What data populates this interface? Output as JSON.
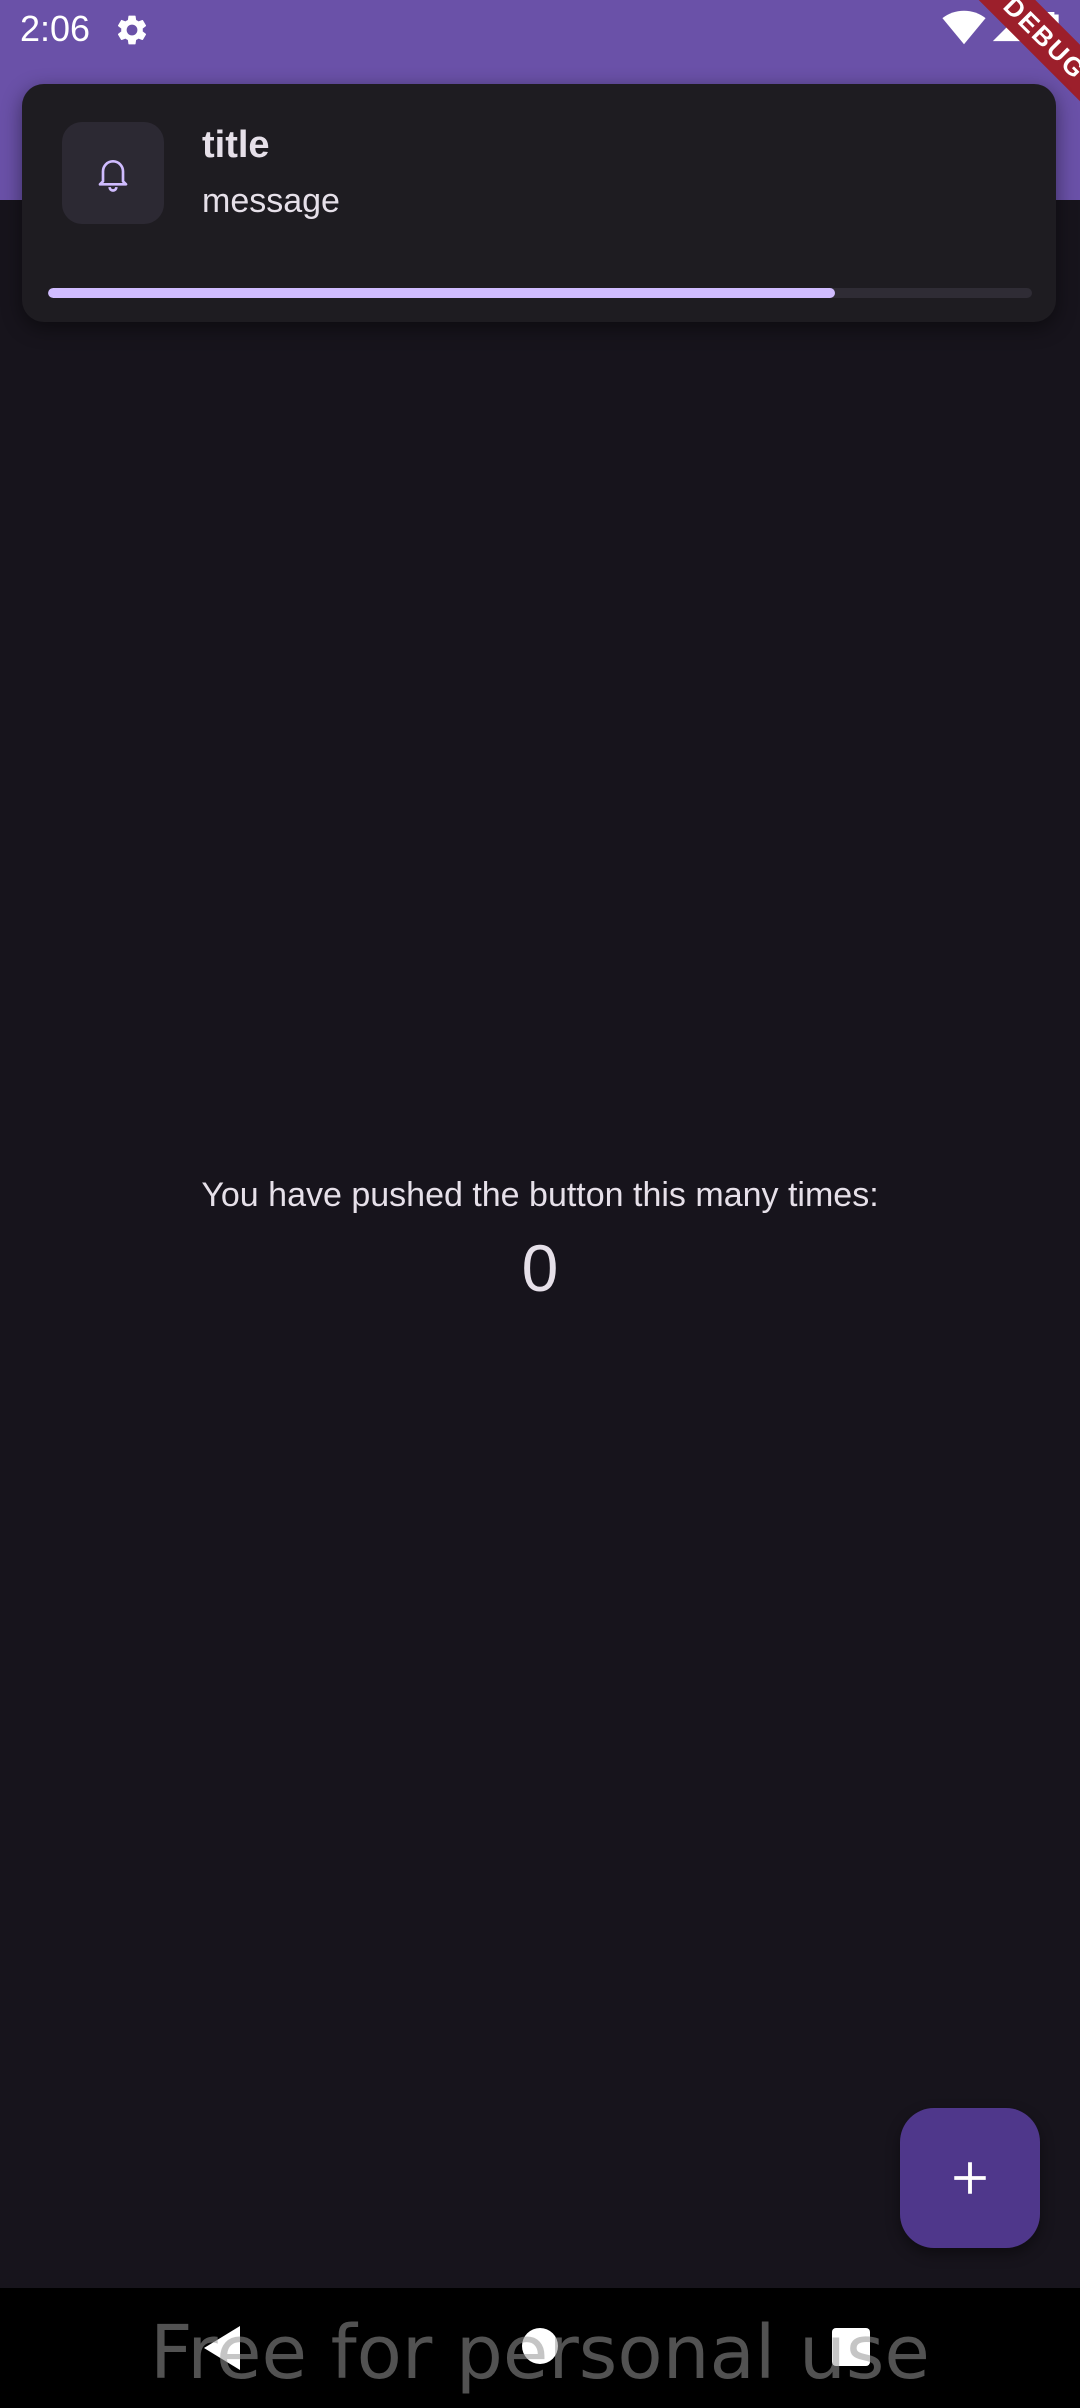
{
  "status_bar": {
    "time": "2:06",
    "icons": [
      "gear-icon",
      "wifi-icon",
      "signal-icon",
      "battery-charging-icon"
    ]
  },
  "debug_banner": {
    "label": "DEBUG"
  },
  "notification": {
    "icon": "bell-icon",
    "title": "title",
    "message": "message",
    "progress_fraction": 0.8
  },
  "counter": {
    "caption": "You have pushed the button this many times:",
    "value": "0"
  },
  "fab": {
    "icon": "plus-icon"
  },
  "nav_bar": {
    "icons": [
      "back-icon",
      "home-icon",
      "recents-icon"
    ]
  },
  "watermark": {
    "text": "Free for personal use"
  },
  "colors": {
    "app_bar": "#6a51a8",
    "background": "#17141c",
    "card": "#1e1c21",
    "progress_fill": "#d0bcff",
    "fab": "#4f378b",
    "debug_ribbon": "#9c1f2b"
  }
}
